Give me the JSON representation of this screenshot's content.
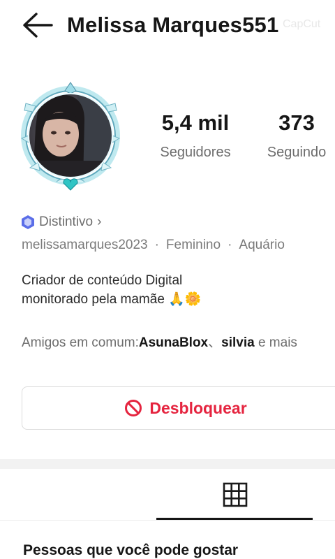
{
  "header": {
    "title": "Melissa Marques551",
    "watermark": "CapCut"
  },
  "profile": {
    "followers_count": "5,4 mil",
    "followers_label": "Seguidores",
    "following_count": "373",
    "following_label": "Seguindo",
    "badge_label": "Distintivo",
    "badge_chevron": "›",
    "username": "melissamarques2023",
    "gender": "Feminino",
    "sign": "Aquário",
    "separator": "·",
    "bio_line1": "Criador de conteúdo Digital",
    "bio_line2": "monitorado pela mamãe 🙏🌼",
    "mutual_prefix": "Amigos em comum:",
    "mutual_friend1": "AsunaBlox",
    "mutual_sep": "、",
    "mutual_friend2": "silvia",
    "mutual_suffix": " e mais"
  },
  "actions": {
    "unblock_label": "Desbloquear"
  },
  "suggestions": {
    "title": "Pessoas que você pode gostar"
  },
  "colors": {
    "accent_red": "#e5243f",
    "badge_blue": "#5b6ee8",
    "frame_teal": "#7fd6e3"
  }
}
